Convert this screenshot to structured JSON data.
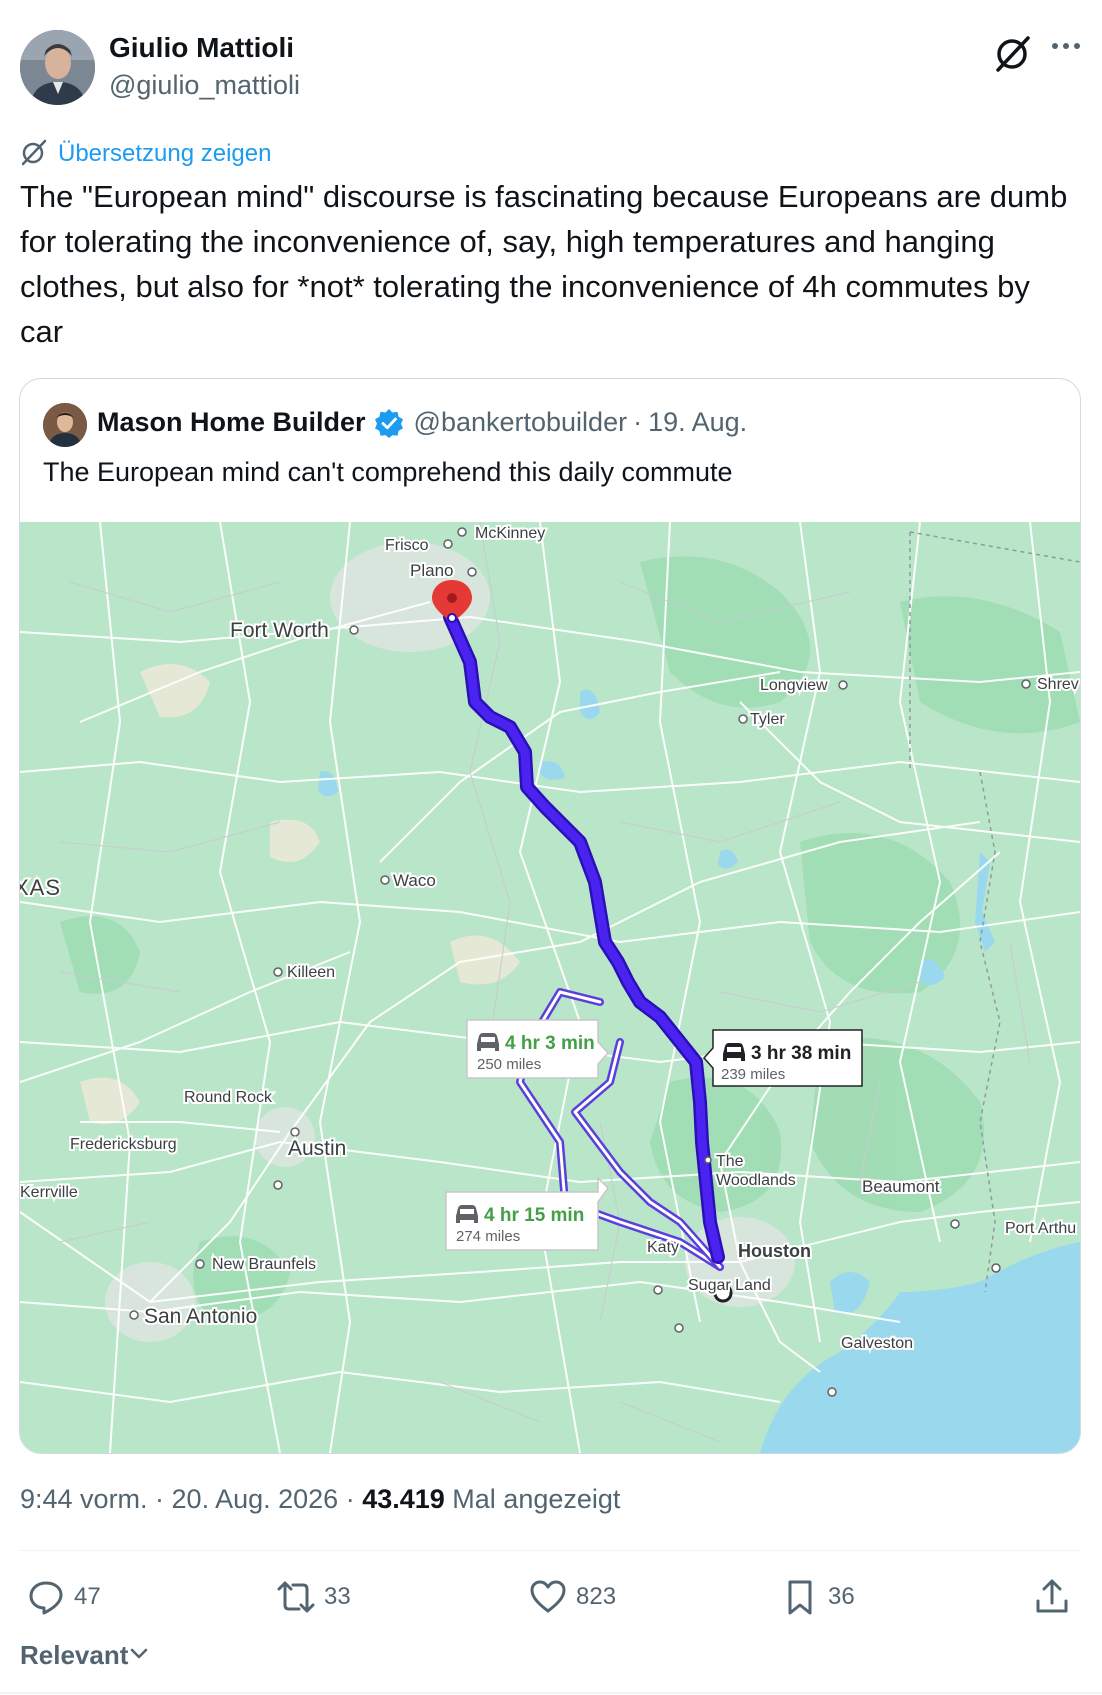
{
  "post": {
    "author": {
      "name": "Giulio Mattioli",
      "handle": "@giulio_mattioli"
    },
    "translate_label": "Übersetzung zeigen",
    "text": "The \"European mind\" discourse is fascinating because Europeans are dumb for tolerating the inconvenience of, say, high temperatures and hanging clothes, but also for *not* tolerating the inconvenience of 4h commutes by car",
    "timestamp": "9:44 vorm. · 20. Aug. 2026 · ",
    "views_count": "43.419",
    "views_label": " Mal angezeigt",
    "actions": {
      "replies": "47",
      "reposts": "33",
      "likes": "823",
      "bookmarks": "36"
    },
    "sort_label": "Relevant"
  },
  "quoted": {
    "author": {
      "name": "Mason Home Builder",
      "handle": "@bankertobuilder"
    },
    "separator": "·",
    "date": "19. Aug.",
    "text": "The European mind can't comprehend this daily commute"
  },
  "map": {
    "cities": {
      "mckinney": "McKinney",
      "frisco": "Frisco",
      "plano": "Plano",
      "fort_worth": "Fort Worth",
      "longview": "Longview",
      "tyler": "Tyler",
      "shreveport": "Shrev",
      "texas": "XAS",
      "waco": "Waco",
      "killeen": "Killeen",
      "round_rock": "Round Rock",
      "fredericksburg": "Fredericksburg",
      "austin": "Austin",
      "kerrville": "Kerrville",
      "new_braunfels": "New Braunfels",
      "san_antonio": "San Antonio",
      "the": "The",
      "woodlands": "Woodlands",
      "beaumont": "Beaumont",
      "port_arthur": "Port Arthu",
      "katy": "Katy",
      "houston": "Houston",
      "sugar_land": "Sugar Land",
      "galveston": "Galveston"
    },
    "routes": [
      {
        "time": "3 hr 38 min",
        "distance": "239 miles",
        "selected": true
      },
      {
        "time": "4 hr 3 min",
        "distance": "250 miles",
        "selected": false
      },
      {
        "time": "4 hr 15 min",
        "distance": "274 miles",
        "selected": false
      }
    ],
    "colors": {
      "land": "#b8e6c9",
      "water": "#9ad8ee",
      "route_selected": "#3f16e8",
      "route_alt": "#8b7cf0",
      "alt_time": "#43a047"
    }
  }
}
